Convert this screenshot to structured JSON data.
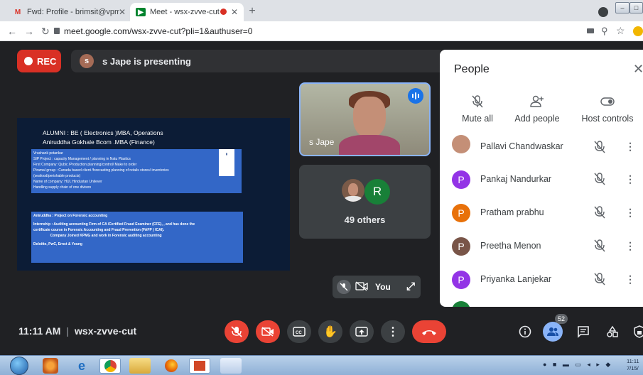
{
  "browser": {
    "tabs": [
      {
        "title": "Fwd: Profile - brimsit@vpmthane",
        "icon": "gmail-icon",
        "active": false
      },
      {
        "title": "Meet - wsx-zvve-cut",
        "icon": "meet-icon",
        "active": true
      }
    ],
    "url": "meet.google.com/wsx-zvve-cut?pli=1&authuser=0",
    "window_buttons": [
      "–",
      "□"
    ]
  },
  "meet": {
    "rec_label": "REC",
    "presenter_initial": "s",
    "presenting_text": "s Jape is presenting",
    "self_tile_name": "s Jape",
    "others_avatar_initial": "R",
    "others_label": "49 others",
    "you_label": "You",
    "slide": {
      "title_line1": "ALUMNI : BE ( Electronics )MBA, Operations",
      "title_line2": "Aniruddha  Gokhale  Bcom .MBA (Finance)",
      "box1_lines": [
        "Vrushank potankar",
        "SIP Project : capacity Management / planning in Natu Plastics",
        "First Company:  Qubic /Production planning/control/ Make to order",
        "Piramal group : Canada based client /forecasting planning of retails stores/ inventories",
        "(seafood/perishable products)",
        "Name of company: HUL  Hindustan Unilever",
        "Handling supply chain of one divison"
      ],
      "box2_lines": [
        "Aniruddha : Project on Forensic accounting",
        "",
        "Internship : Auditing accounting Firm of CA /Certified Fraud Examiner (CFE), , and has done the",
        "certificate course in Forensic Accounting and Fraud Prevention (FAFP ) ICAI).",
        "                 Company Joined KPMG and work in Forensic auditing accounting",
        "",
        "Deloitte, PwC, Ernst & Young"
      ]
    },
    "bottom": {
      "time": "11:11 AM",
      "separator": "|",
      "meeting_code": "wsx-zvve-cut",
      "participants_count": "52"
    }
  },
  "people_panel": {
    "title": "People",
    "actions": [
      {
        "label": "Mute all",
        "icon": "mic-off-icon"
      },
      {
        "label": "Add people",
        "icon": "add-person-icon"
      },
      {
        "label": "Host controls",
        "icon": "toggle-icon"
      }
    ],
    "participants": [
      {
        "name": "Pallavi Chandwaskar",
        "initial": "",
        "color": "#c48f77"
      },
      {
        "name": "Pankaj Nandurkar",
        "initial": "P",
        "color": "#9334e6"
      },
      {
        "name": "Pratham prabhu",
        "initial": "P",
        "color": "#e8710a"
      },
      {
        "name": "Preetha Menon",
        "initial": "P",
        "color": "#795548"
      },
      {
        "name": "Priyanka Lanjekar",
        "initial": "P",
        "color": "#9334e6"
      }
    ]
  },
  "taskbar": {
    "clock_line1": "11:11",
    "clock_line2": "7/15/"
  },
  "colors": {
    "meet_bg": "#202124",
    "end_call": "#ea4335",
    "accent_blue": "#1a73e8"
  }
}
